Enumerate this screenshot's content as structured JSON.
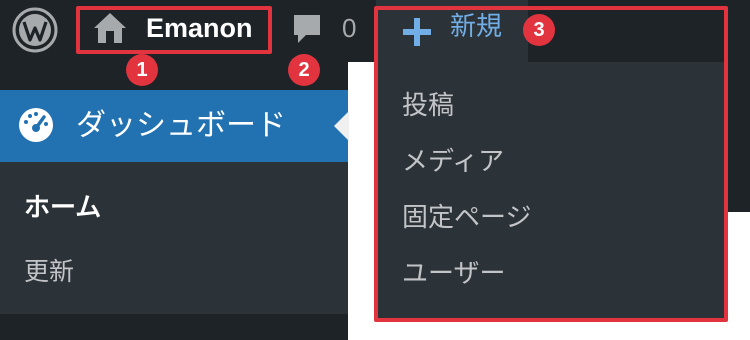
{
  "admin_bar": {
    "logo_icon": "wordpress-logo-icon",
    "site_name": "Emanon",
    "home_icon": "home-icon",
    "comments_icon": "speech-bubble-icon",
    "comment_count": "0",
    "new_icon": "plus-icon",
    "new_label": "新規"
  },
  "sidebar": {
    "active_icon": "dashboard-gauge-icon",
    "active_label": "ダッシュボード",
    "submenu": [
      "ホーム",
      "更新"
    ]
  },
  "new_dropdown": {
    "items": [
      "投稿",
      "メディア",
      "固定ページ",
      "ユーザー"
    ]
  },
  "annotations": {
    "badges": [
      "1",
      "2",
      "3"
    ],
    "color": "#e1343f"
  },
  "colors": {
    "admin_bar": "#1d2327",
    "submenu_bg": "#2c3338",
    "active_menu": "#2271b1",
    "link_blue": "#72aee6"
  }
}
